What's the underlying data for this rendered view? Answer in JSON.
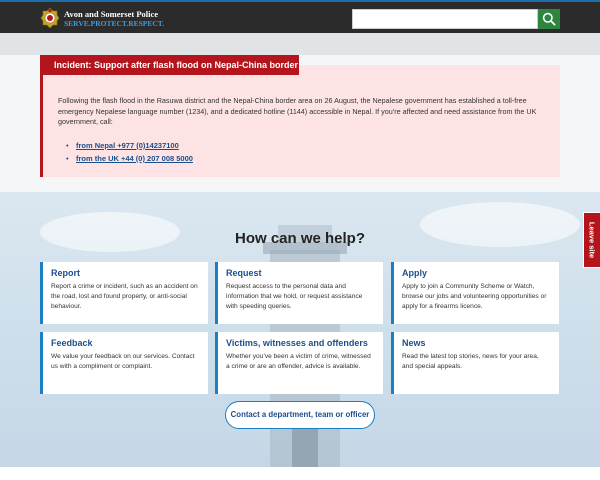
{
  "header": {
    "brand_name": "Avon and Somerset Police",
    "motto": "SERVE.PROTECT.RESPECT.",
    "logo_icon": "police-crest-icon",
    "search": {
      "placeholder": "",
      "button_icon": "search-icon"
    }
  },
  "incident": {
    "title": "Incident: Support after flash flood on Nepal-China border",
    "body": "Following the flash flood in the Rasuwa district and the Nepal-China border area on 26 August, the Nepalese government has established a toll-free emergency Nepalese language number (1234), and a dedicated hotline (1144) accessible in Nepal. If you’re affected and need assistance from the UK government, call:",
    "links": [
      "from Nepal +977 (0)14237100",
      "from the UK +44 (0) 207 008 5000"
    ]
  },
  "help": {
    "title": "How can we help?",
    "cards": [
      {
        "title": "Report",
        "desc": "Report a crime or incident, such as an accident on the road, lost and found property, or anti-social behaviour."
      },
      {
        "title": "Request",
        "desc": "Request access to the personal data and information that we hold, or request assistance with speeding queries."
      },
      {
        "title": "Apply",
        "desc": "Apply to join a Community Scheme or Watch, browse our jobs and volunteering opportunities or apply for a firearms licence."
      },
      {
        "title": "Feedback",
        "desc": "We value your feedback on our services. Contact us with a compliment or complaint."
      },
      {
        "title": "Victims, witnesses and offenders",
        "desc": "Whether you’ve been a victim of crime, witnessed a crime or are an offender, advice is available."
      },
      {
        "title": "News",
        "desc": "Read the latest top stories, news for your area, and special appeals."
      }
    ],
    "contact_button": "Contact a department, team or officer"
  },
  "leave_site": "Leave site",
  "colors": {
    "header_bg": "#2b2b2b",
    "accent_blue": "#1b7fc4",
    "link_blue": "#1b4f8c",
    "alert_red": "#b4151d",
    "alert_bg": "#fde3e3",
    "search_green": "#2e8540"
  }
}
